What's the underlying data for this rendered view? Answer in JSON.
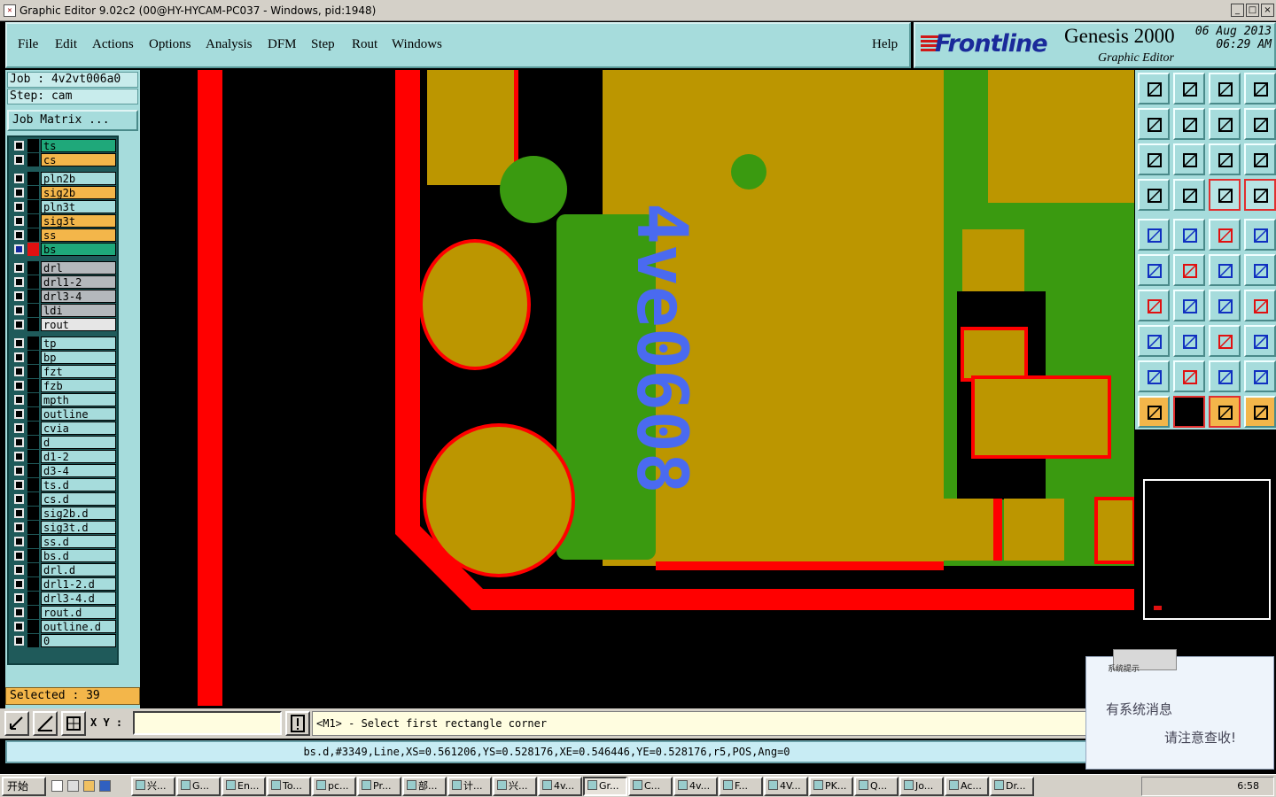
{
  "window": {
    "title": "Graphic Editor 9.02c2 (00@HY-HYCAM-PC037 - Windows, pid:1948)",
    "controls": [
      "_",
      "□",
      "×"
    ]
  },
  "menu": {
    "items": [
      "File",
      "Edit",
      "Actions",
      "Options",
      "Analysis",
      "DFM",
      "Step",
      "Rout",
      "Windows"
    ],
    "help": "Help"
  },
  "brand": {
    "logo": "Frontline",
    "product": "Genesis 2000",
    "subtitle": "Graphic Editor",
    "date": "06 Aug 2013",
    "time": "06:29 AM"
  },
  "job": {
    "job_line": "Job : 4v2vt006a0",
    "step_line": "Step: cam",
    "matrix_button": "Job Matrix ..."
  },
  "layers": [
    {
      "name": "ts",
      "color": "#1fa87a"
    },
    {
      "name": "cs",
      "color": "#f3b64a"
    },
    {
      "name": "pln2b",
      "color": "#a6dcdc"
    },
    {
      "name": "sig2b",
      "color": "#f3b64a"
    },
    {
      "name": "pln3t",
      "color": "#a6dcdc"
    },
    {
      "name": "sig3t",
      "color": "#f3b64a"
    },
    {
      "name": "ss",
      "color": "#f3b64a"
    },
    {
      "name": "bs",
      "color": "#1fa87a",
      "active": true
    },
    {
      "name": "drl",
      "color": "#b4b8bc"
    },
    {
      "name": "drl1-2",
      "color": "#b4b8bc"
    },
    {
      "name": "drl3-4",
      "color": "#b4b8bc"
    },
    {
      "name": "ldi",
      "color": "#b4b8bc"
    },
    {
      "name": "rout",
      "color": "#e6e6e6"
    },
    {
      "name": "tp",
      "color": "#a6dcdc"
    },
    {
      "name": "bp",
      "color": "#a6dcdc"
    },
    {
      "name": "fzt",
      "color": "#a6dcdc"
    },
    {
      "name": "fzb",
      "color": "#a6dcdc"
    },
    {
      "name": "mpth",
      "color": "#a6dcdc"
    },
    {
      "name": "outline",
      "color": "#a6dcdc"
    },
    {
      "name": "cvia",
      "color": "#a6dcdc"
    },
    {
      "name": "d",
      "color": "#a6dcdc"
    },
    {
      "name": "d1-2",
      "color": "#a6dcdc"
    },
    {
      "name": "d3-4",
      "color": "#a6dcdc"
    },
    {
      "name": "ts.d",
      "color": "#a6dcdc"
    },
    {
      "name": "cs.d",
      "color": "#a6dcdc"
    },
    {
      "name": "sig2b.d",
      "color": "#a6dcdc"
    },
    {
      "name": "sig3t.d",
      "color": "#a6dcdc"
    },
    {
      "name": "ss.d",
      "color": "#a6dcdc"
    },
    {
      "name": "bs.d",
      "color": "#a6dcdc"
    },
    {
      "name": "drl.d",
      "color": "#a6dcdc"
    },
    {
      "name": "drl1-2.d",
      "color": "#a6dcdc"
    },
    {
      "name": "drl3-4.d",
      "color": "#a6dcdc"
    },
    {
      "name": "rout.d",
      "color": "#a6dcdc"
    },
    {
      "name": "outline.d",
      "color": "#a6dcdc"
    },
    {
      "name": "0",
      "color": "#a6dcdc"
    }
  ],
  "selected": "Selected : 39",
  "canvas_text": "4ve0608",
  "bottom": {
    "xy_label": "X Y :",
    "xy_value": "",
    "message": "<M1> - Select first rectangle corner"
  },
  "status": "bs.d,#3349,Line,XS=0.561206,YS=0.528176,XE=0.546446,YE=0.528176,r5,POS,Ang=0",
  "popup": {
    "title": "系统提示",
    "line1": "有系统消息",
    "line2": "请注意查收!"
  },
  "taskbar": {
    "start": "开始",
    "tasks": [
      "兴...",
      "G...",
      "En...",
      "To...",
      "pc...",
      "Pr...",
      "部...",
      "计...",
      "兴...",
      "4v...",
      "Gr...",
      "C...",
      "4v...",
      "F...",
      "4V...",
      "PK...",
      "Q...",
      "Jo...",
      "Ac...",
      "Dr..."
    ],
    "clock": "6:58"
  }
}
